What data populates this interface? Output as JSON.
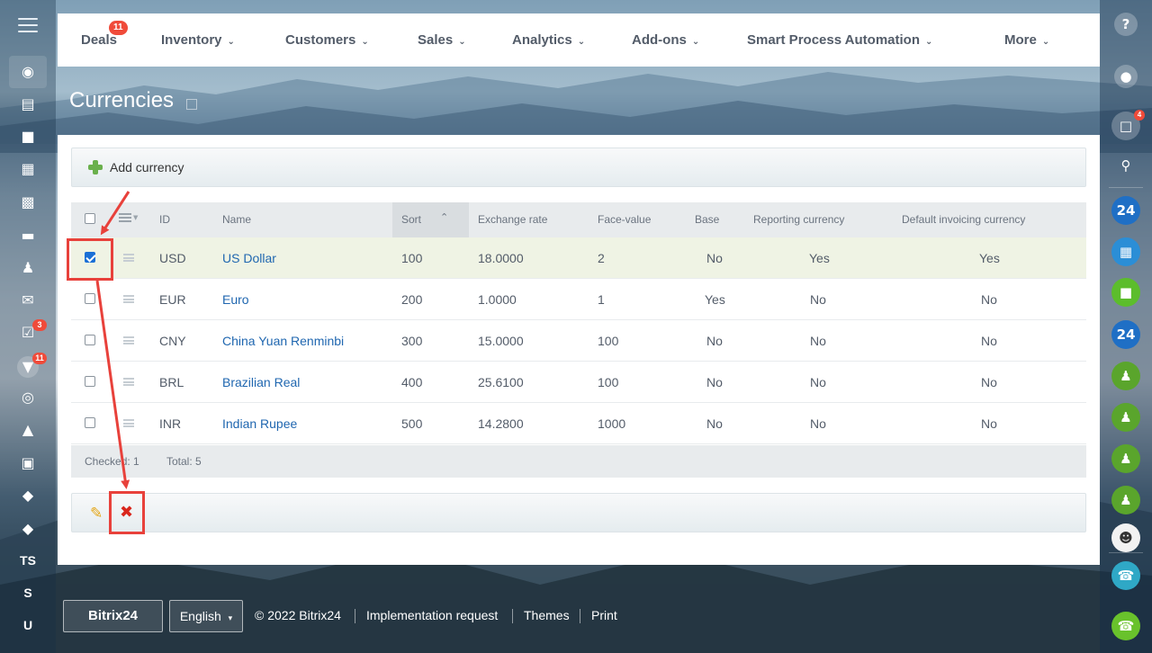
{
  "top_menu": {
    "items": [
      {
        "label": "Deals",
        "badge": "11"
      },
      {
        "label": "Inventory"
      },
      {
        "label": "Customers"
      },
      {
        "label": "Sales"
      },
      {
        "label": "Analytics"
      },
      {
        "label": "Add-ons"
      },
      {
        "label": "Smart Process Automation"
      },
      {
        "label": "More"
      }
    ]
  },
  "left_sidebar": {
    "badges": {
      "tasks": "3",
      "crm": "11"
    },
    "shortcuts": [
      "TS",
      "S",
      "U"
    ]
  },
  "right_sidebar": {
    "help": "?",
    "chat_badge": "4",
    "b24_label": "24"
  },
  "page": {
    "title": "Currencies"
  },
  "toolbar": {
    "add_label": "Add currency"
  },
  "grid": {
    "columns": [
      "ID",
      "Name",
      "Sort",
      "Exchange rate",
      "Face-value",
      "Base",
      "Reporting currency",
      "Default invoicing currency"
    ],
    "rows": [
      {
        "id": "USD",
        "name": "US Dollar",
        "sort": "100",
        "rate": "18.0000",
        "face": "2",
        "base": "No",
        "reporting": "Yes",
        "invoicing": "Yes",
        "checked": true
      },
      {
        "id": "EUR",
        "name": "Euro",
        "sort": "200",
        "rate": "1.0000",
        "face": "1",
        "base": "Yes",
        "reporting": "No",
        "invoicing": "No",
        "checked": false
      },
      {
        "id": "CNY",
        "name": "China Yuan Renminbi",
        "sort": "300",
        "rate": "15.0000",
        "face": "100",
        "base": "No",
        "reporting": "No",
        "invoicing": "No",
        "checked": false
      },
      {
        "id": "BRL",
        "name": "Brazilian Real",
        "sort": "400",
        "rate": "25.6100",
        "face": "100",
        "base": "No",
        "reporting": "No",
        "invoicing": "No",
        "checked": false
      },
      {
        "id": "INR",
        "name": "Indian Rupee",
        "sort": "500",
        "rate": "14.2800",
        "face": "1000",
        "base": "No",
        "reporting": "No",
        "invoicing": "No",
        "checked": false
      }
    ],
    "footer": {
      "checked": "Checked: 1",
      "total": "Total: 5"
    }
  },
  "footer": {
    "brand": "Bitrix24",
    "language": "English",
    "copyright": "© 2022 Bitrix24",
    "links": [
      "Implementation request",
      "Themes",
      "Print"
    ]
  },
  "colors": {
    "accent_link": "#2067b0",
    "annotation": "#e8413b",
    "selected_row": "#eff3e4"
  }
}
